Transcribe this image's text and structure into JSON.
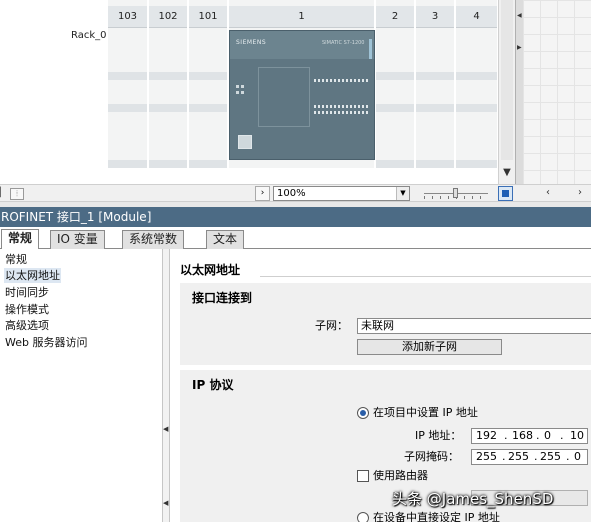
{
  "device_view": {
    "rack_name": "Rack_0",
    "slots": [
      "103",
      "102",
      "101",
      "1",
      "2",
      "3",
      "4"
    ],
    "cpu_brand": "SIEMENS",
    "cpu_model": "SIMATIC S7-1200"
  },
  "toolbar": {
    "zoom_value": "100%"
  },
  "inspector": {
    "title": "ROFINET 接口_1 [Module]",
    "tabs": [
      {
        "label": "常规"
      },
      {
        "label": "IO 变量"
      },
      {
        "label": "系统常数"
      },
      {
        "label": "文本"
      }
    ],
    "tree": [
      {
        "label": "常规"
      },
      {
        "label": "以太网地址"
      },
      {
        "label": "时间同步"
      },
      {
        "label": "操作模式"
      },
      {
        "label": "高级选项"
      },
      {
        "label": "Web 服务器访问"
      }
    ]
  },
  "form": {
    "section_title": "以太网地址",
    "interface_group": {
      "title": "接口连接到",
      "subnet_label": "子网：",
      "subnet_value": "未联网",
      "add_subnet_button": "添加新子网"
    },
    "ip_group": {
      "title": "IP 协议",
      "set_in_project_label": "在项目中设置 IP 地址",
      "ip_label": "IP 地址：",
      "ip_octets": [
        "192",
        "168",
        "0",
        "10"
      ],
      "mask_label": "子网掩码：",
      "mask_octets": [
        "255",
        "255",
        "255",
        "0"
      ],
      "use_router_label": "使用路由器",
      "router_label": "路",
      "set_on_device_label": "在设备中直接设定 IP 地址"
    }
  },
  "watermark": "头条 @James_ShenSD",
  "colors": {
    "title_bar": "#4c6b85",
    "cpu_body": "#5f7682",
    "group_bg": "#f0f0f0",
    "selection": "#dde7f2"
  }
}
